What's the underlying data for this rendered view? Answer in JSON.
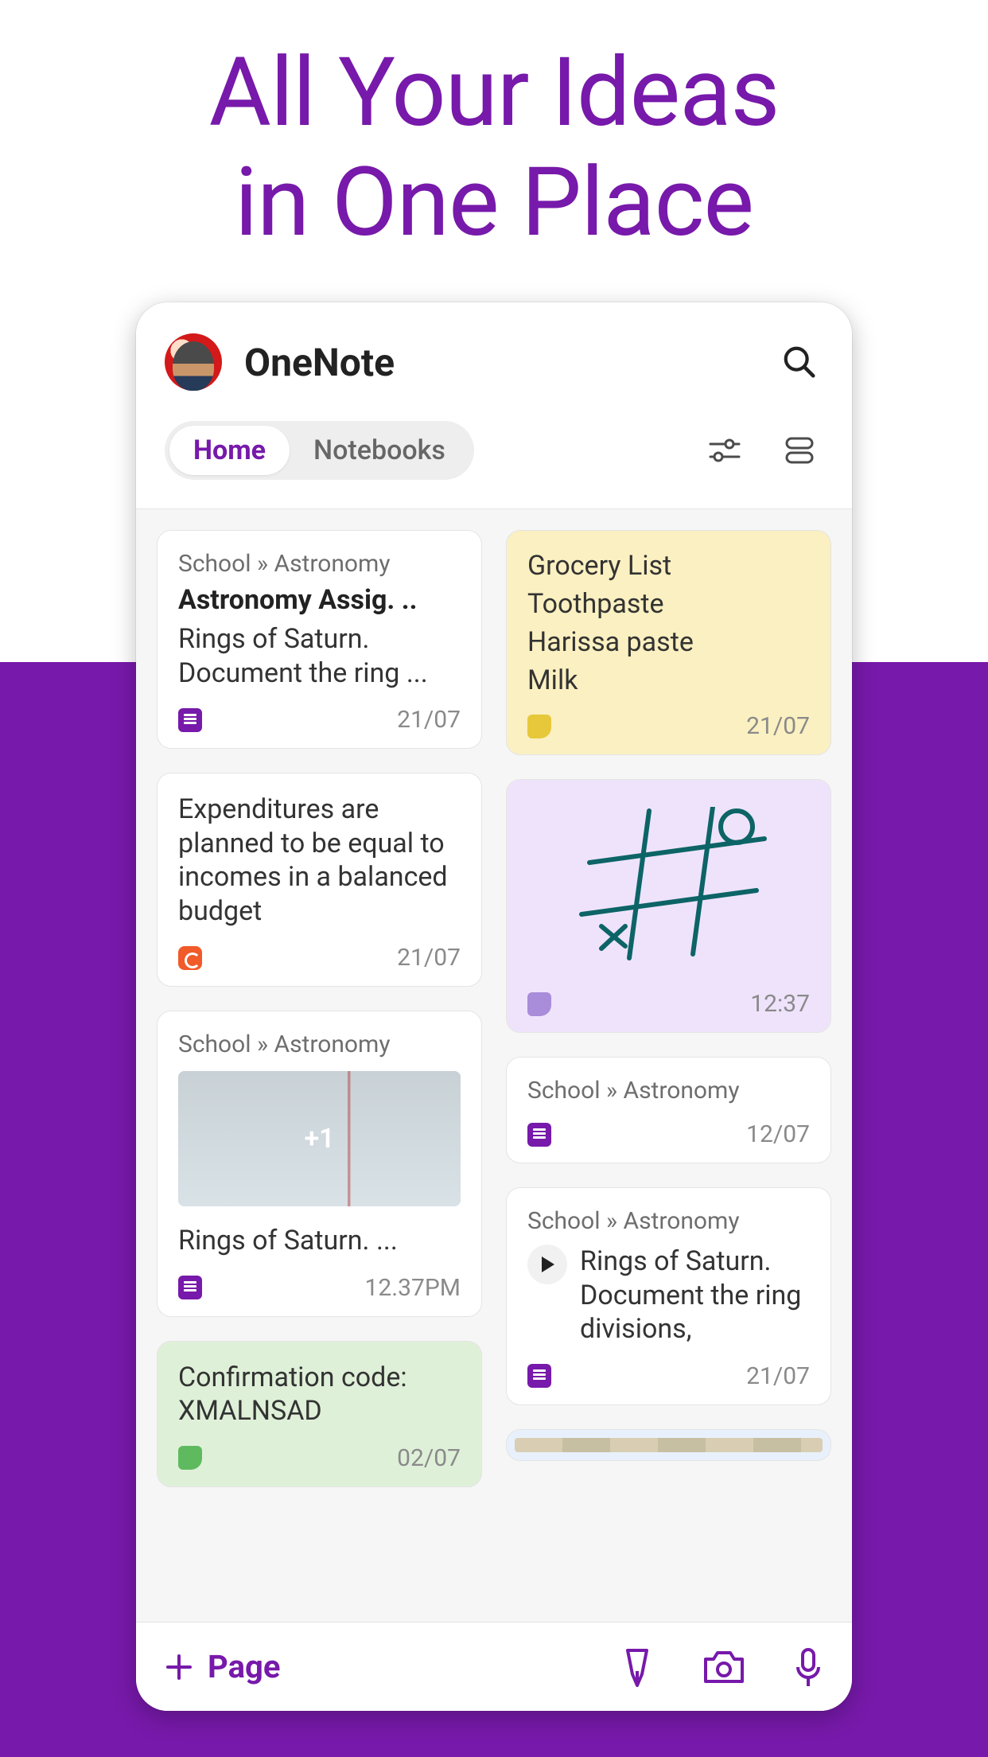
{
  "promo": {
    "line1": "All Your Ideas",
    "line2": "in One Place"
  },
  "header": {
    "title": "OneNote",
    "tabs": {
      "home": "Home",
      "notebooks": "Notebooks"
    }
  },
  "bottom": {
    "newPage": "Page"
  },
  "left": [
    {
      "crumb": "School » Astronomy",
      "title": "Astronomy Assig. ..",
      "body": "Rings of Saturn. Document the ring ...",
      "time": "21/07",
      "chip": "chip-purple"
    },
    {
      "body": "Expenditures are planned to be equal to incomes in a balanced budget",
      "time": "21/07",
      "chip": "chip-orange"
    },
    {
      "crumb": "School » Astronomy",
      "thumbOverlay": "+1",
      "title2": "Rings of Saturn. ...",
      "time": "12.37PM",
      "chip": "chip-purple"
    },
    {
      "body": "Confirmation code: XMALNSAD",
      "time": "02/07",
      "chip": "chip-green",
      "color": "green"
    }
  ],
  "right": [
    {
      "lines": [
        "Grocery List",
        "Toothpaste",
        "Harissa paste",
        "Milk"
      ],
      "time": "21/07",
      "chip": "chip-yellow",
      "color": "yellow"
    },
    {
      "drawing": true,
      "time": "12:37",
      "chip": "chip-lilac",
      "color": "lilac"
    },
    {
      "crumb": "School » Astronomy",
      "time": "12/07",
      "chip": "chip-purple"
    },
    {
      "crumb": "School » Astronomy",
      "audioBody": "Rings of Saturn. Document the ring divisions,",
      "time": "21/07",
      "chip": "chip-purple"
    },
    {
      "imageCard": true,
      "color": "blue"
    }
  ]
}
